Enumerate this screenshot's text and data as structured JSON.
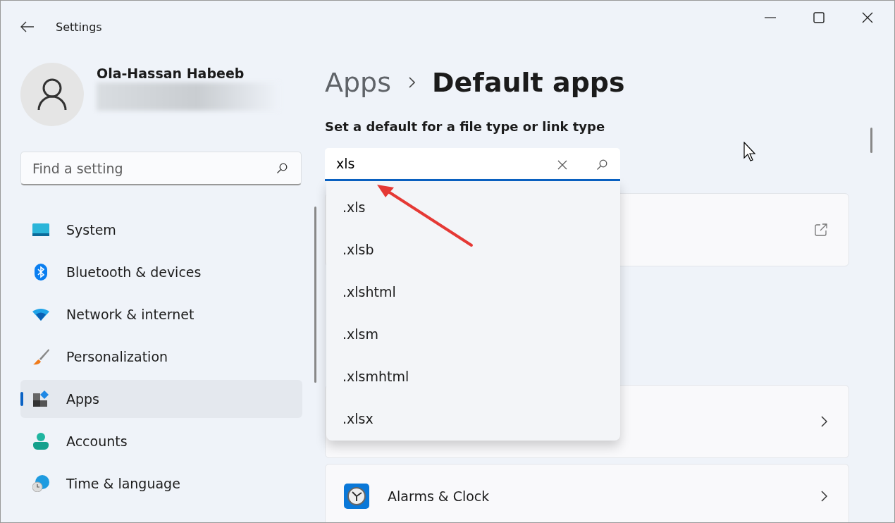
{
  "window": {
    "title": "Settings"
  },
  "user": {
    "name": "Ola-Hassan Habeeb"
  },
  "sidebar": {
    "search": {
      "placeholder": "Find a setting"
    },
    "items": [
      {
        "label": "System",
        "kind": "system",
        "selected": false
      },
      {
        "label": "Bluetooth & devices",
        "kind": "bluetooth",
        "selected": false
      },
      {
        "label": "Network & internet",
        "kind": "network",
        "selected": false
      },
      {
        "label": "Personalization",
        "kind": "brush",
        "selected": false
      },
      {
        "label": "Apps",
        "kind": "apps",
        "selected": true
      },
      {
        "label": "Accounts",
        "kind": "accounts",
        "selected": false
      },
      {
        "label": "Time & language",
        "kind": "time",
        "selected": false
      }
    ]
  },
  "breadcrumb": [
    "Apps",
    "Default apps"
  ],
  "section_title": "Set a default for a file type or link type",
  "file_type_search": {
    "value": "xls",
    "suggestions": [
      ".xls",
      ".xlsb",
      ".xlshtml",
      ".xlsm",
      ".xlsmhtml",
      ".xlsx"
    ]
  },
  "cards": [
    {
      "kind": "external"
    },
    {
      "kind": "chevron"
    },
    {
      "kind": "app",
      "label": "Alarms & Clock"
    }
  ]
}
